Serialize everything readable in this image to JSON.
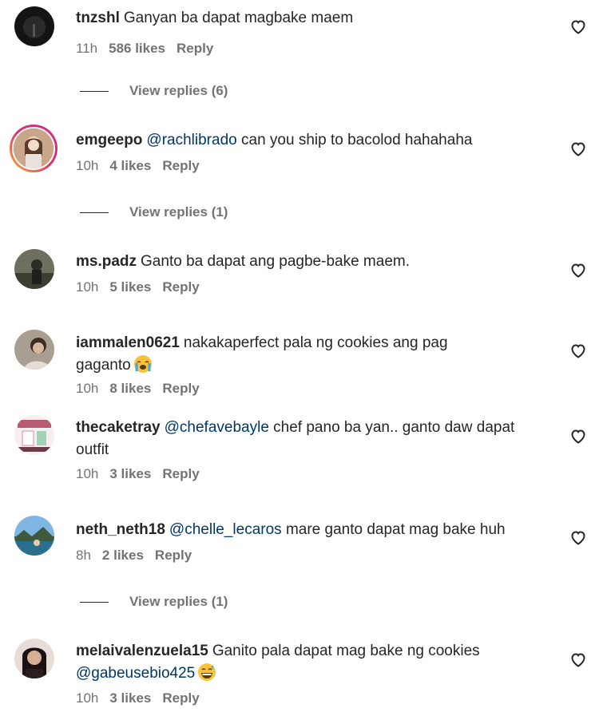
{
  "comments": [
    {
      "username": "tnzshl",
      "text": "Ganyan ba dapat magbake maem",
      "time": "11h",
      "likes": "586 likes",
      "reply": "Reply",
      "view_replies": "View replies (6)"
    },
    {
      "username": "emgeepo",
      "mention": "@rachlibrado",
      "text": "can you ship to bacolod hahahaha",
      "time": "10h",
      "likes": "4 likes",
      "reply": "Reply",
      "view_replies": "View replies (1)"
    },
    {
      "username": "ms.padz",
      "text": "Ganto ba dapat ang pagbe-bake maem.",
      "time": "10h",
      "likes": "5 likes",
      "reply": "Reply"
    },
    {
      "username": "iammalen0621",
      "text": "nakakaperfect pala ng cookies ang pag gaganto",
      "emoji": "loudly-crying-face-emoji",
      "time": "10h",
      "likes": "8 likes",
      "reply": "Reply"
    },
    {
      "username": "thecaketray",
      "mention": "@chefavebayle",
      "text": "chef pano ba yan.. ganto daw dapat outfit",
      "time": "10h",
      "likes": "3 likes",
      "reply": "Reply"
    },
    {
      "username": "neth_neth18",
      "mention": "@chelle_lecaros",
      "text": "mare ganto dapat mag bake huh",
      "time": "8h",
      "likes": "2 likes",
      "reply": "Reply",
      "view_replies": "View replies (1)"
    },
    {
      "username": "melaivalenzuela15",
      "text": "Ganito pala dapat mag bake ng cookies",
      "mention_after": "@gabeusebio425",
      "emoji": "grinning-sweat-face-emoji",
      "time": "10h",
      "likes": "3 likes",
      "reply": "Reply"
    }
  ],
  "colors": {
    "text": "#262626",
    "meta": "#737373",
    "mention": "#00376b"
  },
  "icons": {
    "like": "heart-outline-icon"
  }
}
